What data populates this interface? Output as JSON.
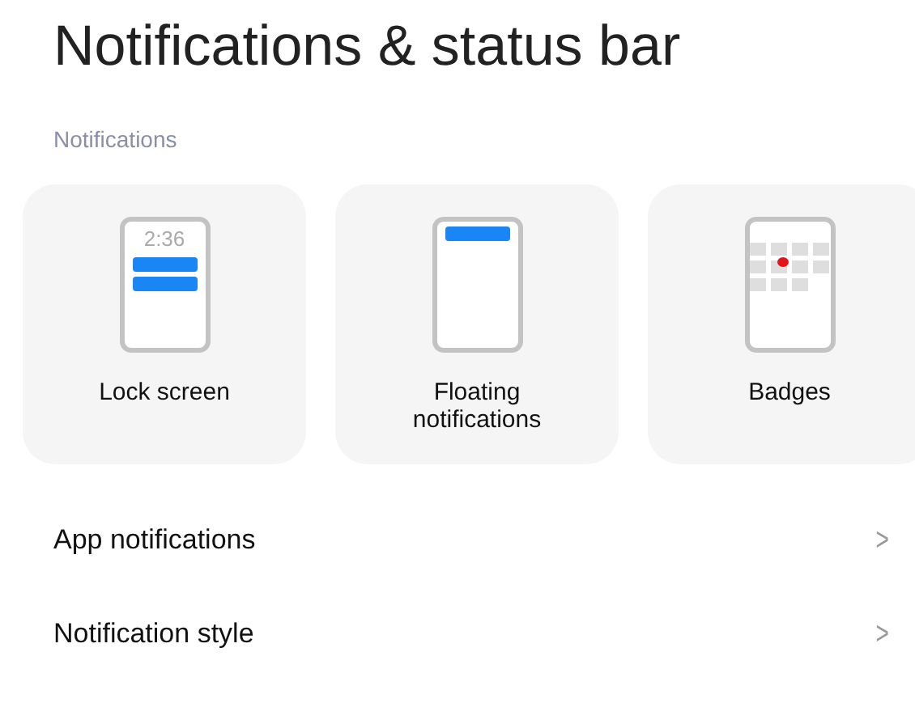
{
  "title": "Notifications & status bar",
  "section": "Notifications",
  "cards": [
    {
      "kind": "lock",
      "label": "Lock screen",
      "time": "2:36"
    },
    {
      "kind": "floating",
      "label": "Floating notifications"
    },
    {
      "kind": "badges",
      "label": "Badges"
    }
  ],
  "rows": [
    {
      "label": "App notifications",
      "chevron": ">"
    },
    {
      "label": "Notification style",
      "chevron": ">"
    }
  ]
}
